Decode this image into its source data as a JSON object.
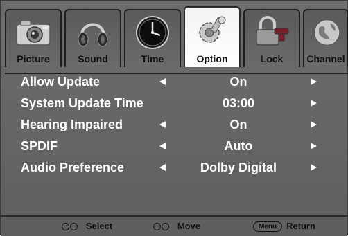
{
  "tabs": [
    {
      "label": "Picture",
      "icon": "camera-icon",
      "active": false
    },
    {
      "label": "Sound",
      "icon": "headphones-icon",
      "active": false
    },
    {
      "label": "Time",
      "icon": "clock-icon",
      "active": false
    },
    {
      "label": "Option",
      "icon": "gears-icon",
      "active": true
    },
    {
      "label": "Lock",
      "icon": "padlock-icon",
      "active": false
    },
    {
      "label": "Channel",
      "icon": "globe-icon",
      "active": false
    }
  ],
  "menu": {
    "items": [
      {
        "label": "Allow Update",
        "value": "On",
        "left_arrow": true,
        "right_arrow": true
      },
      {
        "label": "System Update Time",
        "value": "03:00",
        "left_arrow": false,
        "right_arrow": true
      },
      {
        "label": "Hearing Impaired",
        "value": "On",
        "left_arrow": true,
        "right_arrow": true
      },
      {
        "label": "SPDIF",
        "value": "Auto",
        "left_arrow": true,
        "right_arrow": true
      },
      {
        "label": "Audio Preference",
        "value": "Dolby Digital",
        "left_arrow": true,
        "right_arrow": true
      }
    ]
  },
  "footer": {
    "select_label": "Select",
    "move_label": "Move",
    "menu_key": "Menu",
    "return_label": "Return"
  }
}
